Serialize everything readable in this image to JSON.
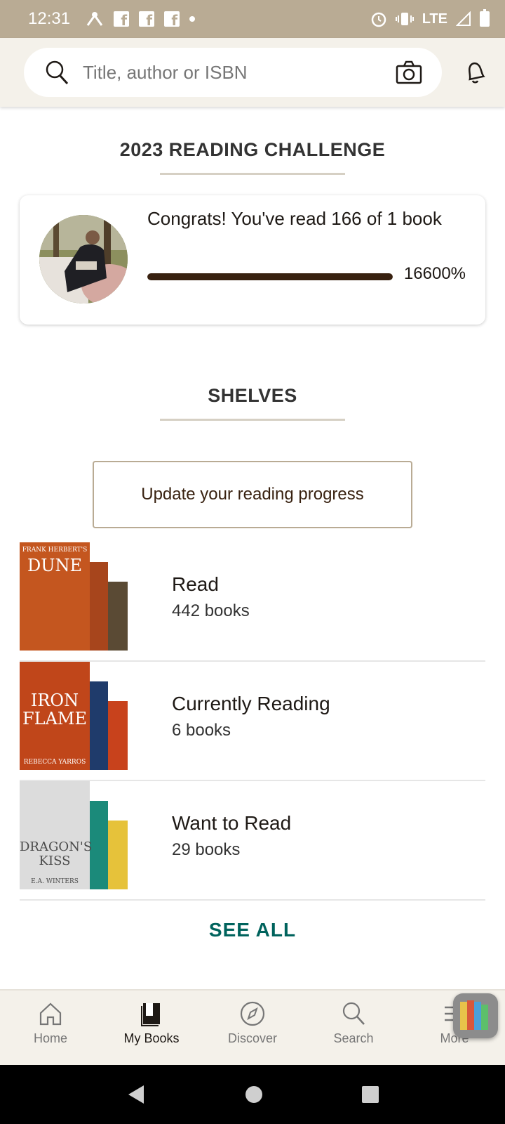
{
  "status_bar": {
    "time": "12:31",
    "network": "LTE"
  },
  "search": {
    "placeholder": "Title, author or ISBN"
  },
  "challenge": {
    "title": "2023 READING CHALLENGE",
    "message": "Congrats! You've read 166 of 1 book",
    "percent_label": "16600%",
    "progress": 1.0
  },
  "shelves": {
    "title": "SHELVES",
    "update_button": "Update your reading progress",
    "items": [
      {
        "name": "Read",
        "count": "442 books",
        "cover_title": "DUNE",
        "cover_author": "FRANK HERBERT'S",
        "colors": [
          "#c4561f",
          "#a7451c",
          "#5a4a34"
        ]
      },
      {
        "name": "Currently Reading",
        "count": "6 books",
        "cover_title": "IRON FLAME",
        "cover_author": "REBECCA YARROS",
        "colors": [
          "#c0461a",
          "#1f3b6b",
          "#c8421c"
        ]
      },
      {
        "name": "Want to Read",
        "count": "29 books",
        "cover_title": "DRAGON'S KISS",
        "cover_author": "E.A. WINTERS",
        "colors": [
          "#dcdcdc",
          "#1b8a7a",
          "#e6c23a"
        ]
      }
    ],
    "see_all": "SEE ALL"
  },
  "bottom_nav": [
    {
      "label": "Home",
      "icon": "home-icon",
      "active": false
    },
    {
      "label": "My Books",
      "icon": "my-books-icon",
      "active": true
    },
    {
      "label": "Discover",
      "icon": "compass-icon",
      "active": false
    },
    {
      "label": "Search",
      "icon": "search-icon",
      "active": false
    },
    {
      "label": "More",
      "icon": "menu-icon",
      "active": false
    }
  ]
}
